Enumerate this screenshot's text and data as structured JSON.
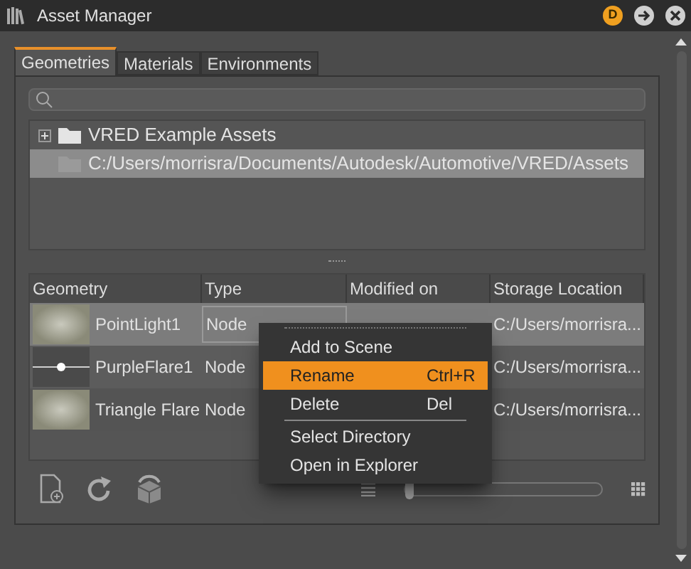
{
  "window": {
    "title": "Asset Manager",
    "badge": "D"
  },
  "tabs": [
    {
      "label": "Geometries",
      "selected": true
    },
    {
      "label": "Materials",
      "selected": false
    },
    {
      "label": "Environments",
      "selected": false
    }
  ],
  "tree": [
    {
      "label": "VRED Example Assets",
      "kind": "group",
      "expanded": false,
      "selected": false
    },
    {
      "label": "C:/Users/morrisra/Documents/Autodesk/Automotive/VRED/Assets",
      "kind": "folder",
      "selected": true
    }
  ],
  "table": {
    "columns": [
      "Geometry",
      "Type",
      "Modified on",
      "Storage Location"
    ],
    "rows": [
      {
        "kind": "glow",
        "name": "PointLight1",
        "type": "Node",
        "location": "C:/Users/morrisra...",
        "selected": true
      },
      {
        "kind": "flare",
        "name": "PurpleFlare1",
        "type": "Node",
        "location": "C:/Users/morrisra...",
        "selected": false
      },
      {
        "kind": "glow",
        "name": "Triangle Flare",
        "type": "Node",
        "location": "C:/Users/morrisra...",
        "selected": false
      }
    ]
  },
  "context_menu": [
    {
      "label": "Add to Scene",
      "selected": false
    },
    {
      "label": "Rename",
      "shortcut": "Ctrl+R",
      "selected": true
    },
    {
      "label": "Delete",
      "shortcut": "Del",
      "selected": false
    },
    {
      "kind": "separator"
    },
    {
      "label": "Select Directory",
      "selected": false
    },
    {
      "label": "Open in Explorer",
      "selected": false
    }
  ],
  "size_slider": {
    "level": 0
  }
}
